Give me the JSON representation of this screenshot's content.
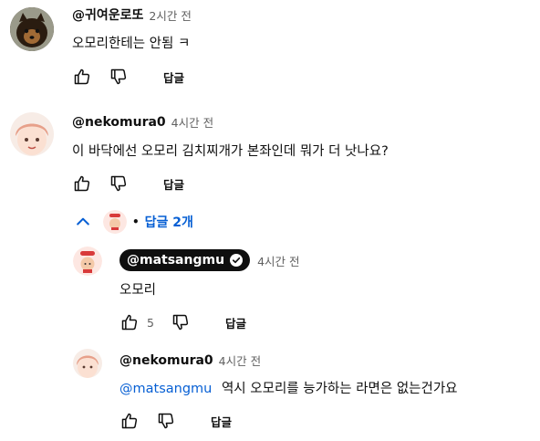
{
  "comments": [
    {
      "author": "@귀여운로또",
      "time": "2시간 전",
      "text": "오모리한테는 안됨 ㅋ",
      "reply_label": "답글"
    },
    {
      "author": "@nekomura0",
      "time": "4시간 전",
      "text": "이 바닥에선 오모리 김치찌개가 본좌인데 뭐가 더 낫나요?",
      "reply_label": "답글"
    }
  ],
  "replies_toggle": {
    "separator": "•",
    "label": "답글 2개",
    "chevron": "chevron-up-icon",
    "color": "#065fd4"
  },
  "replies": [
    {
      "author": "@matsangmu",
      "time": "4시간 전",
      "text": "오모리",
      "likes": "5",
      "reply_label": "답글",
      "is_owner": true
    },
    {
      "author": "@nekomura0",
      "time": "4시간 전",
      "mention": "@matsangmu",
      "text": "역시 오모리를 능가하는 라면은 없는건가요",
      "reply_label": "답글"
    }
  ],
  "icons": {
    "like": "thumbs-up-icon",
    "dislike": "thumbs-down-icon",
    "verified": "verified-check-icon"
  }
}
